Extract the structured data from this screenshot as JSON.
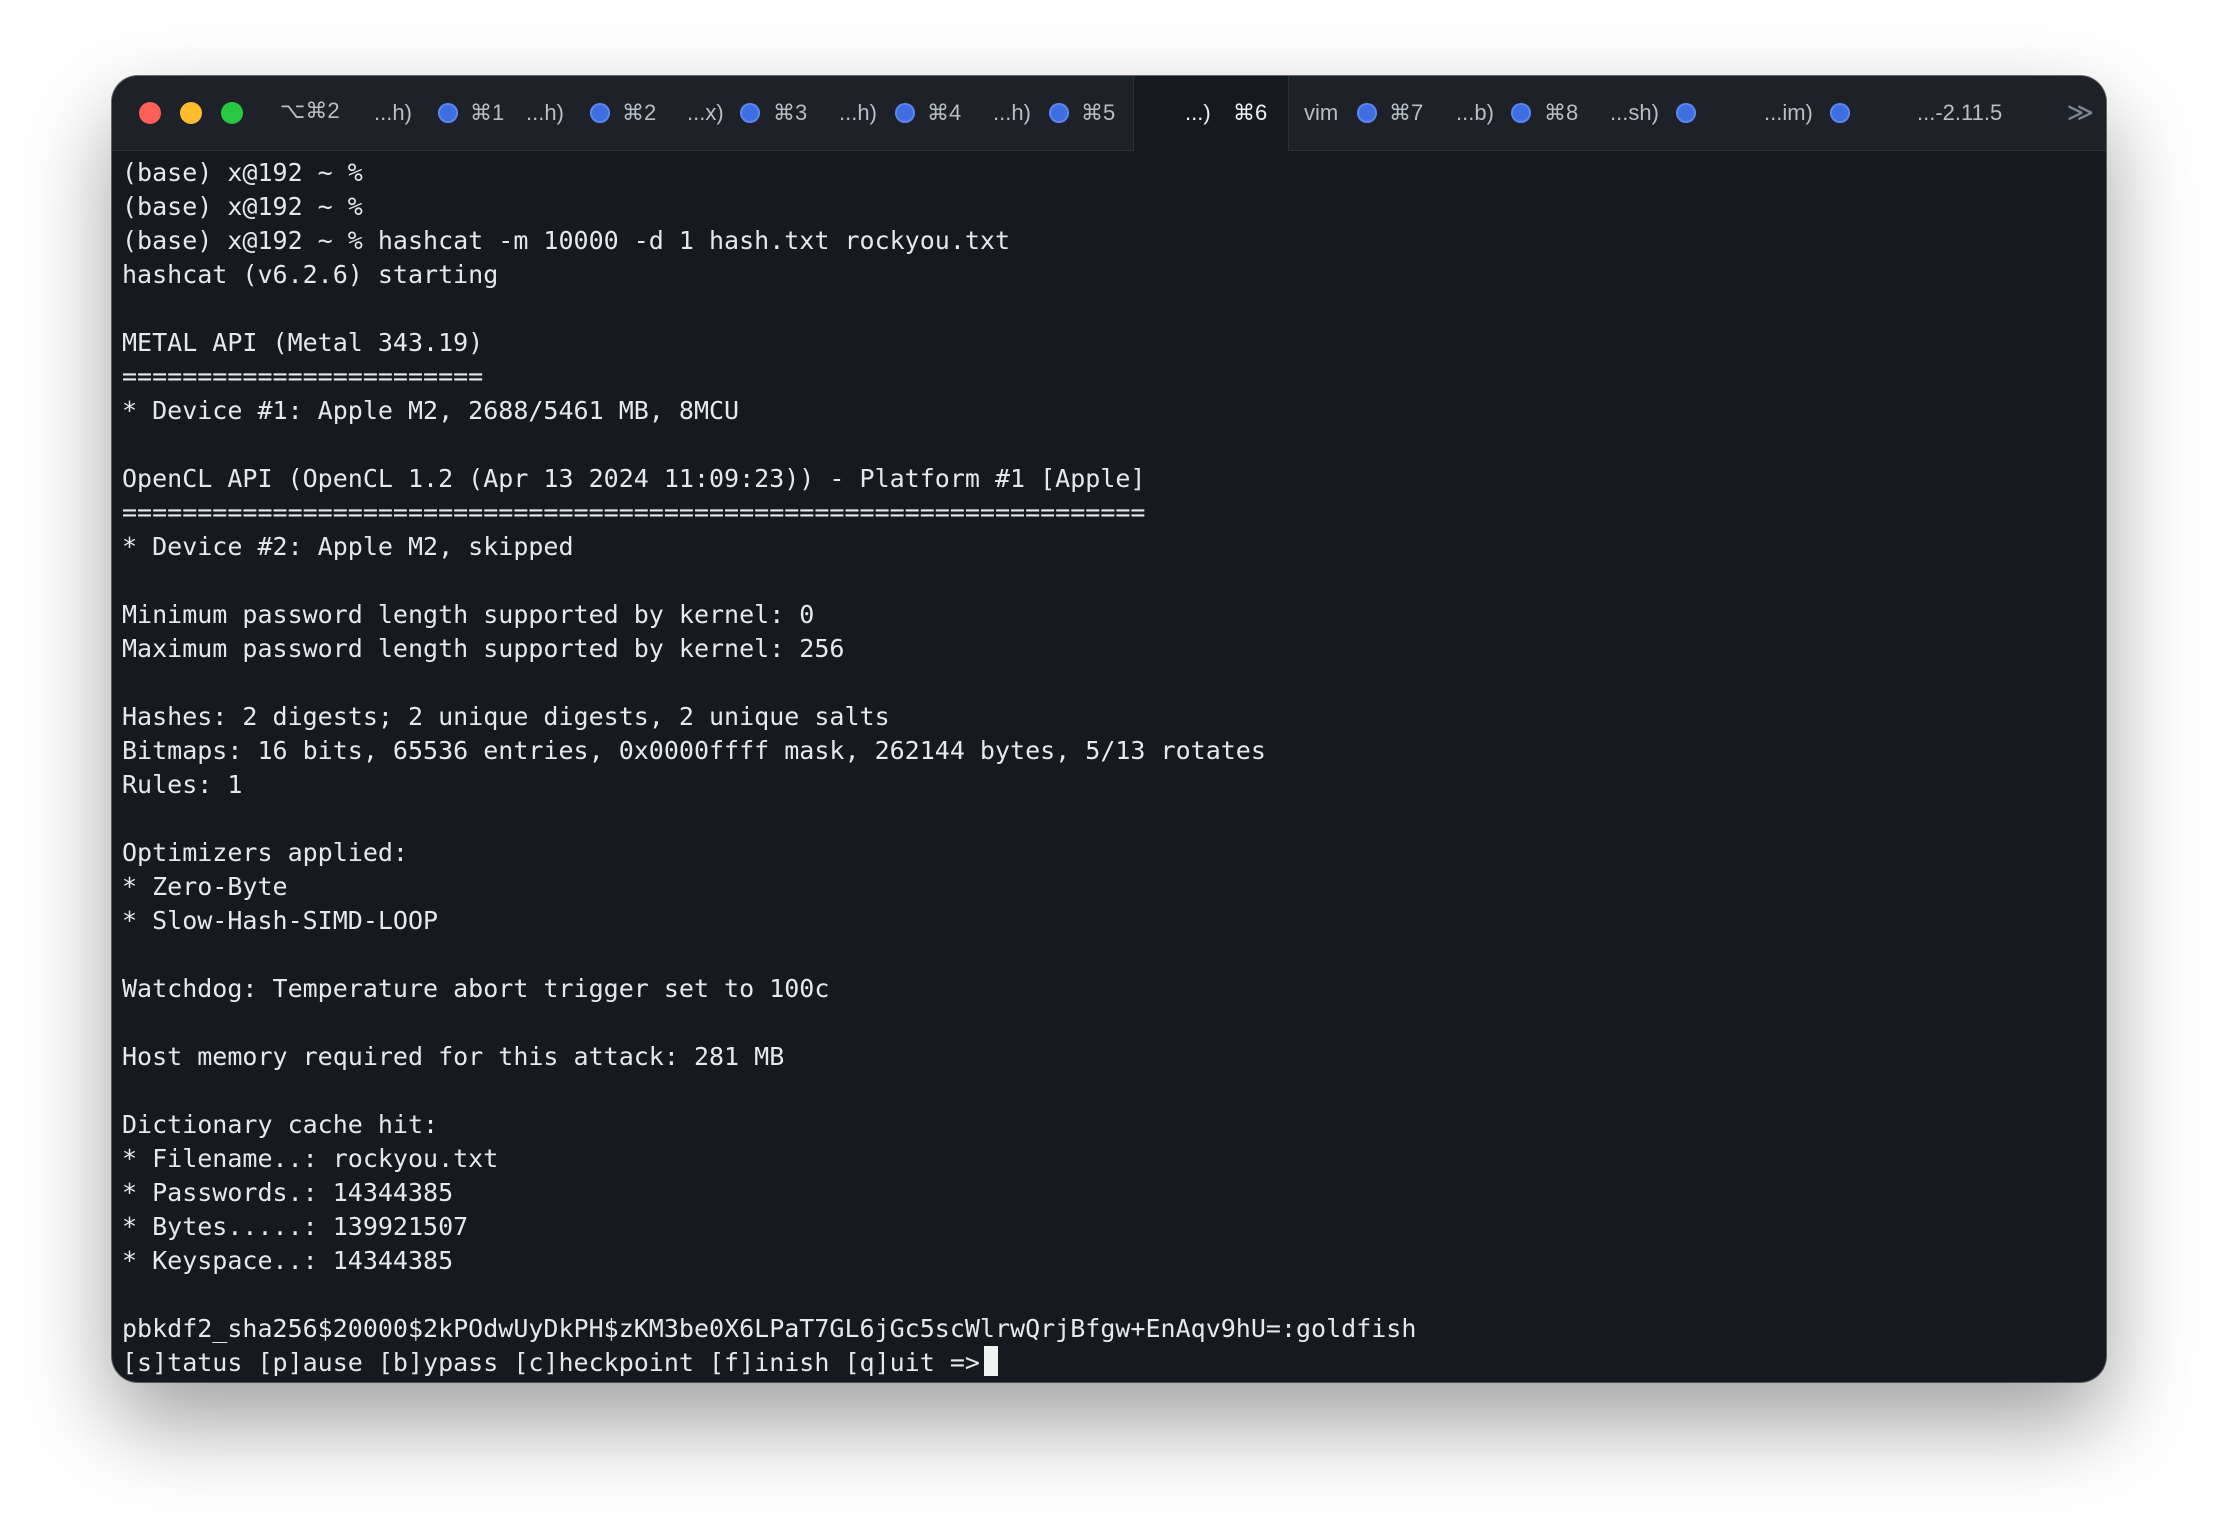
{
  "window": {
    "shortcut": "⌥⌘2",
    "tabs": [
      {
        "label": "...h)",
        "shortcut": "⌘1",
        "dot": true
      },
      {
        "label": "...h)",
        "shortcut": "⌘2",
        "dot": true
      },
      {
        "label": "...x)",
        "shortcut": "⌘3",
        "dot": true
      },
      {
        "label": "...h)",
        "shortcut": "⌘4",
        "dot": true
      },
      {
        "label": "...h)",
        "shortcut": "⌘5",
        "dot": true
      },
      {
        "label": "...)",
        "shortcut": "⌘6",
        "dot": false,
        "active": true
      },
      {
        "label": "vim",
        "shortcut": "⌘7",
        "dot": true
      },
      {
        "label": "...b)",
        "shortcut": "⌘8",
        "dot": true
      },
      {
        "label": "...sh)",
        "shortcut": "",
        "dot": true
      },
      {
        "label": "...im)",
        "shortcut": "",
        "dot": true
      },
      {
        "label": "...-2.11.5",
        "shortcut": "",
        "dot": false
      }
    ],
    "overflow_glyph": "≫",
    "colors": {
      "close": "#fe5f57",
      "minimize": "#febc2e",
      "maximize": "#28c840",
      "tab_dot": "#3f6ee0",
      "background": "#161a20"
    }
  },
  "terminal": {
    "lines": [
      "(base) x@192 ~ %",
      "(base) x@192 ~ %",
      "(base) x@192 ~ % hashcat -m 10000 -d 1 hash.txt rockyou.txt",
      "hashcat (v6.2.6) starting",
      "",
      "METAL API (Metal 343.19)",
      "========================",
      "* Device #1: Apple M2, 2688/5461 MB, 8MCU",
      "",
      "OpenCL API (OpenCL 1.2 (Apr 13 2024 11:09:23)) - Platform #1 [Apple]",
      "====================================================================",
      "* Device #2: Apple M2, skipped",
      "",
      "Minimum password length supported by kernel: 0",
      "Maximum password length supported by kernel: 256",
      "",
      "Hashes: 2 digests; 2 unique digests, 2 unique salts",
      "Bitmaps: 16 bits, 65536 entries, 0x0000ffff mask, 262144 bytes, 5/13 rotates",
      "Rules: 1",
      "",
      "Optimizers applied:",
      "* Zero-Byte",
      "* Slow-Hash-SIMD-LOOP",
      "",
      "Watchdog: Temperature abort trigger set to 100c",
      "",
      "Host memory required for this attack: 281 MB",
      "",
      "Dictionary cache hit:",
      "* Filename..: rockyou.txt",
      "* Passwords.: 14344385",
      "* Bytes.....: 139921507",
      "* Keyspace..: 14344385",
      "",
      "pbkdf2_sha256$20000$2kPOdwUyDkPH$zKM3be0X6LPaT7GL6jGc5scWlrwQrjBfgw+EnAqv9hU=:goldfish"
    ],
    "prompt": "[s]tatus [p]ause [b]ypass [c]heckpoint [f]inish [q]uit =>"
  }
}
